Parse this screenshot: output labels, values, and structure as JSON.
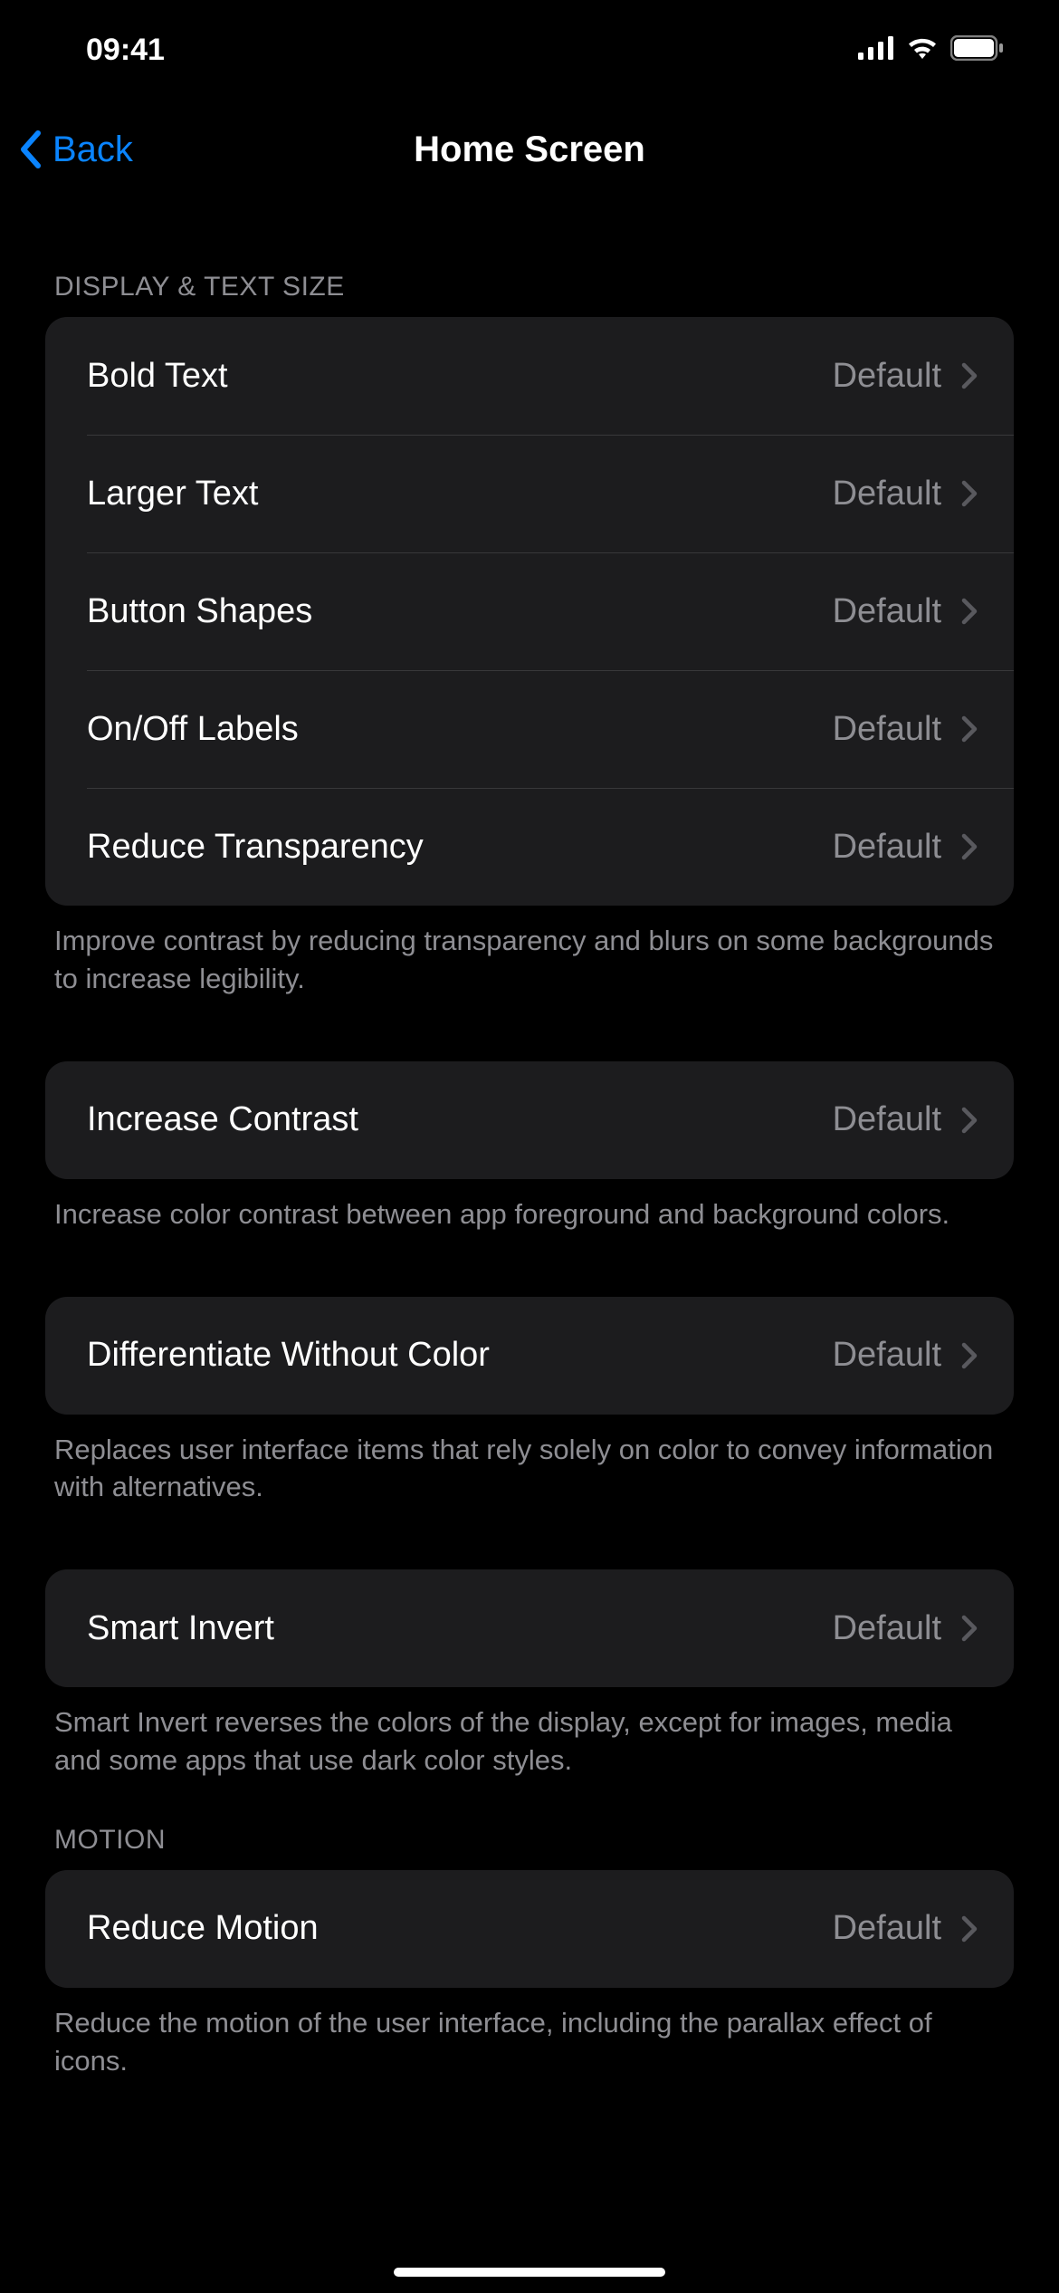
{
  "statusBar": {
    "time": "09:41"
  },
  "nav": {
    "back": "Back",
    "title": "Home Screen"
  },
  "sections": [
    {
      "header": "DISPLAY & TEXT SIZE",
      "groups": [
        {
          "rows": [
            {
              "label": "Bold Text",
              "value": "Default"
            },
            {
              "label": "Larger Text",
              "value": "Default"
            },
            {
              "label": "Button Shapes",
              "value": "Default"
            },
            {
              "label": "On/Off Labels",
              "value": "Default"
            },
            {
              "label": "Reduce Transparency",
              "value": "Default"
            }
          ],
          "footer": "Improve contrast by reducing transparency and blurs on some backgrounds to increase legibility."
        },
        {
          "rows": [
            {
              "label": "Increase Contrast",
              "value": "Default"
            }
          ],
          "footer": "Increase color contrast between app foreground and background colors."
        },
        {
          "rows": [
            {
              "label": "Differentiate Without Color",
              "value": "Default"
            }
          ],
          "footer": "Replaces user interface items that rely solely on color to convey information with alternatives."
        },
        {
          "rows": [
            {
              "label": "Smart Invert",
              "value": "Default"
            }
          ],
          "footer": "Smart Invert reverses the colors of the display, except for images, media and some apps that use dark color styles."
        }
      ]
    },
    {
      "header": "MOTION",
      "groups": [
        {
          "rows": [
            {
              "label": "Reduce Motion",
              "value": "Default"
            }
          ],
          "footer": "Reduce the motion of the user interface, including the parallax effect of icons."
        }
      ]
    }
  ]
}
